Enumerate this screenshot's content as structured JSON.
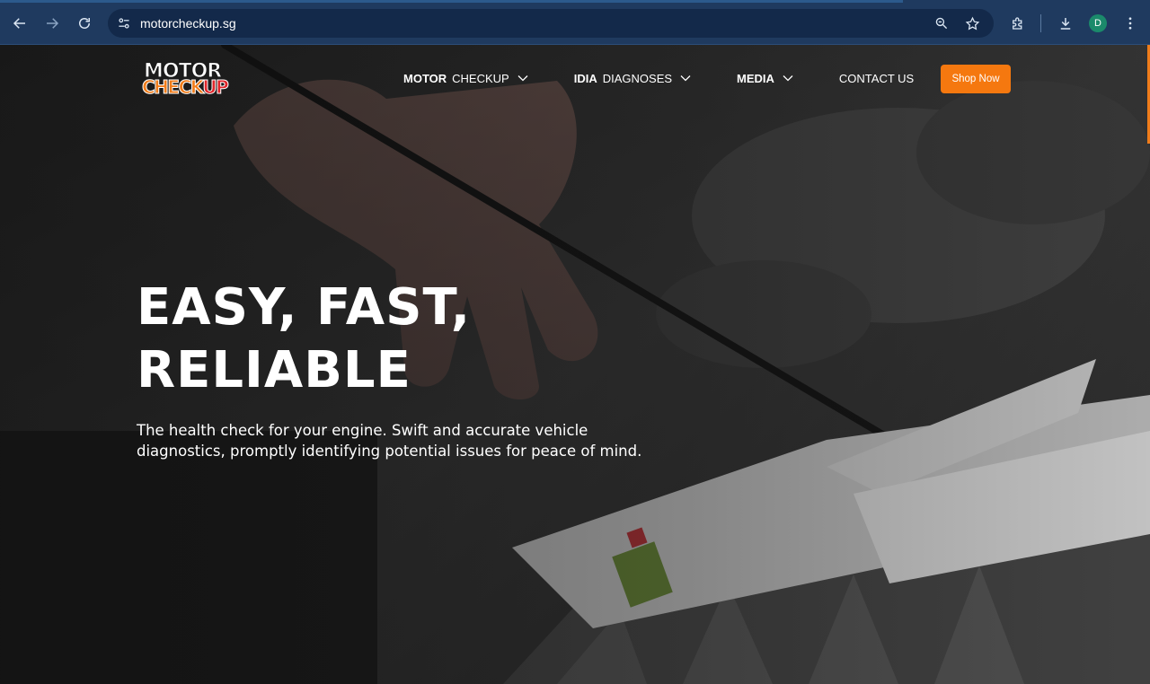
{
  "browser": {
    "url": "motorcheckup.sg",
    "profile_initial": "D",
    "icons": [
      "back-icon",
      "forward-icon",
      "reload-icon",
      "site-settings-icon",
      "zoom-icon",
      "bookmark-star-icon",
      "extensions-icon",
      "download-icon",
      "menu-dots-icon"
    ]
  },
  "site": {
    "logo": {
      "line1": "MOTOR",
      "line2a": "CHECK",
      "line2b": "UP"
    },
    "nav": [
      {
        "bold": "MOTOR",
        "label": "CHECKUP",
        "has_dropdown": true
      },
      {
        "bold": "IDIA",
        "label": "DIAGNOSES",
        "has_dropdown": true
      },
      {
        "bold": "MEDIA",
        "label": "",
        "has_dropdown": true
      },
      {
        "bold": "",
        "label": "CONTACT US",
        "has_dropdown": false
      }
    ],
    "shop_button": "Shop Now",
    "hero": {
      "title_line1": "EASY, FAST,",
      "title_line2": "RELIABLE",
      "subtitle": "The health check for your engine. Swift and accurate vehicle diagnostics, promptly identifying potential issues for peace of mind."
    },
    "colors": {
      "accent": "#f5780f",
      "chrome": "#1f3a5f",
      "omnibox": "#13294a"
    }
  }
}
